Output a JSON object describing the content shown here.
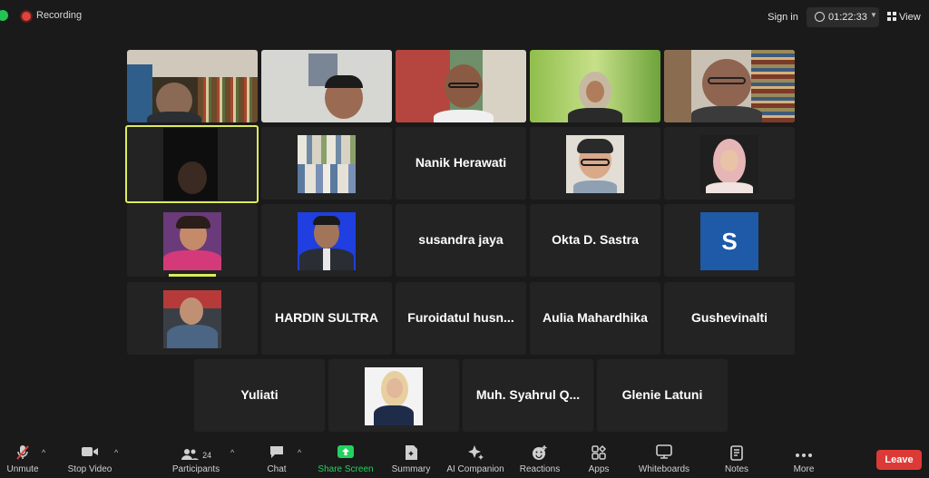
{
  "topbar": {
    "recording_label": "Recording",
    "sign_in_label": "Sign in",
    "meeting_time": "01:22:33",
    "view_label": "View"
  },
  "tiles": {
    "nanik": "Nanik Herawati",
    "susandra": "susandra jaya",
    "okta": "Okta D. Sastra",
    "s_initial": "S",
    "hardin": "HARDIN SULTRA",
    "furoidatul": "Furoidatul  husn...",
    "aulia": "Aulia Mahardhika",
    "gushevinalti": "Gushevinalti",
    "yuliati": "Yuliati",
    "syahrul": "Muh.  Syahrul  Q...",
    "glenie": "Glenie Latuni"
  },
  "toolbar": {
    "unmute": "Unmute",
    "stop_video": "Stop Video",
    "participants": "Participants",
    "participants_count": "24",
    "chat": "Chat",
    "share_screen": "Share Screen",
    "summary": "Summary",
    "ai_companion": "AI Companion",
    "reactions": "Reactions",
    "apps": "Apps",
    "whiteboards": "Whiteboards",
    "notes": "Notes",
    "more": "More",
    "leave": "Leave"
  },
  "colors": {
    "background": "#1a1a1a",
    "tile": "#232323",
    "active_speaker": "#ddeb5b",
    "leave": "#dc3a37",
    "share": "#23d160",
    "recording": "#e0433d"
  }
}
